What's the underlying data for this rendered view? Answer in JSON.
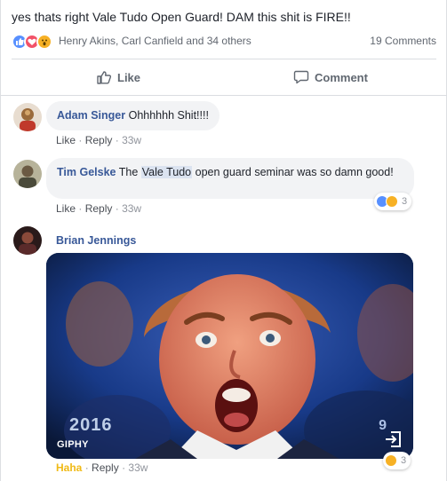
{
  "post": {
    "text": "yes thats right Vale Tudo Open Guard! DAM this shit is FIRE!!",
    "reaction_icons": [
      "like-icon",
      "love-icon",
      "wow-icon"
    ],
    "reactors": "Henry Akins, Carl Canfield and 34 others",
    "comment_count": "19 Comments"
  },
  "actions": {
    "like_label": "Like",
    "comment_label": "Comment"
  },
  "comments": [
    {
      "author": "Adam Singer",
      "text": "Ohhhhhh Shit!!!!",
      "like": "Like",
      "reply": "Reply",
      "time": "33w"
    },
    {
      "author": "Tim Gelske",
      "text_before": "The",
      "highlight": "Vale Tudo",
      "text_after": "open guard seminar was so damn good!",
      "like": "Like",
      "reply": "Reply",
      "time": "33w",
      "reactions_count": "3"
    },
    {
      "author": "Brian Jennings",
      "gif_source": "GIPHY",
      "gif_year": "2016",
      "gif_channel": "9",
      "reaction_label": "Haha",
      "reply": "Reply",
      "time": "33w",
      "reactions_count": "3"
    }
  ],
  "colors": {
    "link": "#385898",
    "like_blue": "#5890ff",
    "love_red": "#f25268",
    "wow_yellow": "#f7b125"
  }
}
